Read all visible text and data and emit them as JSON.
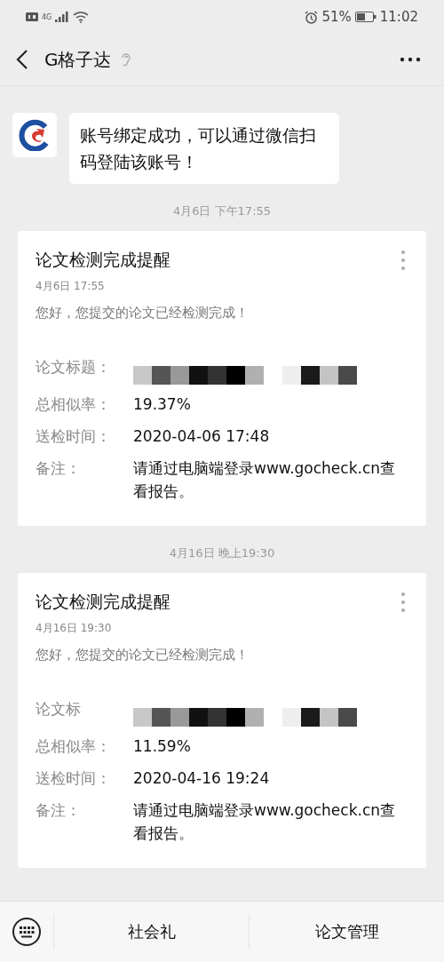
{
  "status_bar": {
    "network": "4G",
    "battery_percent": "51%",
    "time": "11:02"
  },
  "header": {
    "title": "G格子达"
  },
  "messages": [
    {
      "kind": "text",
      "text": "账号绑定成功，可以通过微信扫码登陆该账号！"
    },
    {
      "kind": "timestamp",
      "text": "4月6日 下午17:55"
    },
    {
      "kind": "card",
      "title": "论文检测完成提醒",
      "date": "4月6日  17:55",
      "intro": "您好，您提交的论文已经检测完成！",
      "fields": [
        {
          "kind": "redacted",
          "label": "论文标题："
        },
        {
          "kind": "text",
          "label": "总相似率：",
          "value": "19.37%"
        },
        {
          "kind": "text",
          "label": "送检时间：",
          "value": "2020-04-06 17:48"
        },
        {
          "kind": "text",
          "label": "备注：",
          "value": "请通过电脑端登录www.gocheck.cn查看报告。"
        }
      ]
    },
    {
      "kind": "timestamp",
      "text": "4月16日 晚上19:30"
    },
    {
      "kind": "card",
      "title": "论文检测完成提醒",
      "date": "4月16日  19:30",
      "intro": "您好，您提交的论文已经检测完成！",
      "fields": [
        {
          "kind": "redacted",
          "label": "论文标"
        },
        {
          "kind": "text",
          "label": "总相似率：",
          "value": "11.59%"
        },
        {
          "kind": "text",
          "label": "送检时间：",
          "value": "2020-04-16 19:24"
        },
        {
          "kind": "text",
          "label": "备注：",
          "value": "请通过电脑端登录www.gocheck.cn查看报告。"
        }
      ]
    }
  ],
  "menu_bar": {
    "items": [
      "社会礼",
      "论文管理"
    ]
  }
}
